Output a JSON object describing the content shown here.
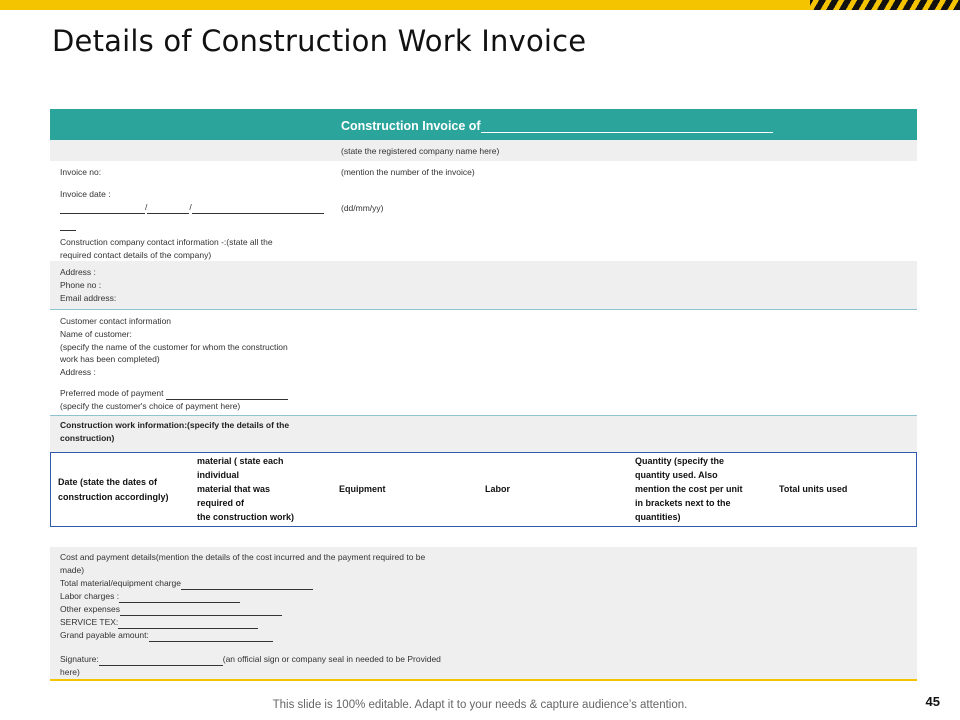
{
  "slide": {
    "title": "Details of Construction Work Invoice",
    "footer": "This slide is 100% editable. Adapt it to your needs & capture audience’s attention.",
    "page_number": "45"
  },
  "colors": {
    "teal": "#2ba49c",
    "yellow": "#f5c400",
    "gray": "#efefef",
    "border_blue": "#2f5aa8"
  },
  "invoice": {
    "header": "Construction Invoice of",
    "header_hint": "(state the registered company name here)",
    "invoice_no_label": "Invoice no:",
    "invoice_no_hint": "(mention the number of the invoice)",
    "invoice_date_label": "Invoice date :",
    "date_format": "(dd/mm/yy)",
    "slash": "/",
    "company_contact_line1": "Construction company contact information -:(state all the",
    "company_contact_line2": "required contact details of the company)",
    "address_label": "Address :",
    "phone_label": "Phone no :",
    "email_label": "Email address:",
    "customer_info": "Customer contact information",
    "customer_name_label": "Name of customer:",
    "customer_hint_line1": "(specify the name of the customer for whom the construction",
    "customer_hint_line2": "work has been completed)",
    "customer_address_label": "Address :",
    "payment_mode_label": "Preferred mode of payment",
    "payment_mode_hint": "(specify the customer's choice of  payment here)",
    "construction_info_line1": "Construction work information:(specify the details of the",
    "construction_info_line2": "construction)"
  },
  "table_headers": {
    "date_line1": "Date (state the dates of",
    "date_line2": "construction accordingly)",
    "material_line1": "material ( state each",
    "material_line2": "individual",
    "material_line3": "material that was",
    "material_line4": "required of",
    "material_line5": "the construction  work)",
    "equipment": "Equipment",
    "labor": "Labor",
    "quantity_line1": "Quantity  (specify the",
    "quantity_line2": "quantity  used.  Also",
    "quantity_line3": "mention  the  cost  per unit",
    "quantity_line4": "in brackets next to the",
    "quantity_line5": "quantities)",
    "total_units": "Total units used"
  },
  "cost": {
    "line1": "Cost and payment details(mention the details of the cost incurred and the payment required to be",
    "line2": "made)",
    "material_charge": "Total material/equipment charge",
    "labor_charges": "Labor charges :",
    "other_expenses": "Other expenses",
    "service_tex": "SERVICE TEX:",
    "grand_payable": "Grand payable amount:",
    "signature": "Signature:",
    "signature_hint": "(an official sign or company seal in needed to be Provided",
    "signature_hint2": "here)"
  }
}
